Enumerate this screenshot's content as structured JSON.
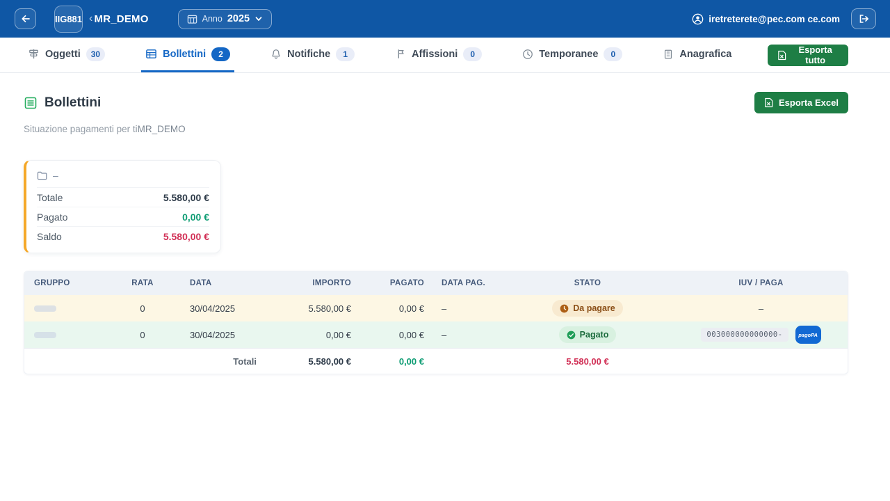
{
  "header": {
    "org_code": "IIG881",
    "org_name": "MR_DEMO",
    "org_prefix": "‹",
    "year_label": "Anno",
    "year_value": "2025",
    "user_email": "iretreterete@pec.com ce.com"
  },
  "tabs": [
    {
      "label": "Oggetti",
      "badge": "30",
      "icon": "signpost-icon",
      "active": false
    },
    {
      "label": "Bollettini",
      "badge": "2",
      "icon": "table-icon",
      "active": true
    },
    {
      "label": "Notifiche",
      "badge": "1",
      "icon": "bell-icon",
      "active": false
    },
    {
      "label": "Affissioni",
      "badge": "0",
      "icon": "flag-icon",
      "active": false
    },
    {
      "label": "Temporanee",
      "badge": "0",
      "icon": "clock-icon",
      "active": false
    },
    {
      "label": "Anagrafica",
      "badge": null,
      "icon": "building-icon",
      "active": false
    }
  ],
  "toolbar": {
    "export_all_label": "Esporta tutto",
    "export_excel_label": "Esporta Excel"
  },
  "page": {
    "title": "Bollettini",
    "subtitle_prefix": "Situazione pagamenti per ti",
    "subtitle_name": "MR_DEMO"
  },
  "summary_card": {
    "group_label": "–",
    "rows": [
      {
        "label": "Totale",
        "value": "5.580,00 €"
      },
      {
        "label": "Pagato",
        "value": "0,00 €"
      },
      {
        "label": "Saldo",
        "value": "5.580,00 €"
      }
    ]
  },
  "table": {
    "columns": [
      "GRUPPO",
      "RATA",
      "DATA",
      "IMPORTO",
      "PAGATO",
      "DATA PAG.",
      "STATO",
      "IUV / PAGA"
    ],
    "rows": [
      {
        "rata": "0",
        "data": "30/04/2025",
        "importo": "5.580,00 €",
        "pagato": "0,00 €",
        "data_pag": "–",
        "stato": "Da pagare",
        "iuv": "–"
      },
      {
        "rata": "0",
        "data": "30/04/2025",
        "importo": "0,00 €",
        "pagato": "0,00 €",
        "data_pag": "–",
        "stato": "Pagato",
        "iuv": "003000000000000-"
      }
    ],
    "totals": {
      "label": "Totali",
      "importo": "5.580,00 €",
      "pagato": "0,00 €",
      "saldo": "5.580,00 €"
    },
    "pagopa_label": "pagoPA"
  },
  "colors": {
    "header_bg": "#0f57a5",
    "active_tab": "#1467c5",
    "green_button": "#1e7e45",
    "card_accent": "#f5a829",
    "money_green": "#0f9d74",
    "money_red": "#d12f55",
    "warning_badge_bg": "#f8ead0",
    "success_badge_bg": "#d8f1e0"
  }
}
